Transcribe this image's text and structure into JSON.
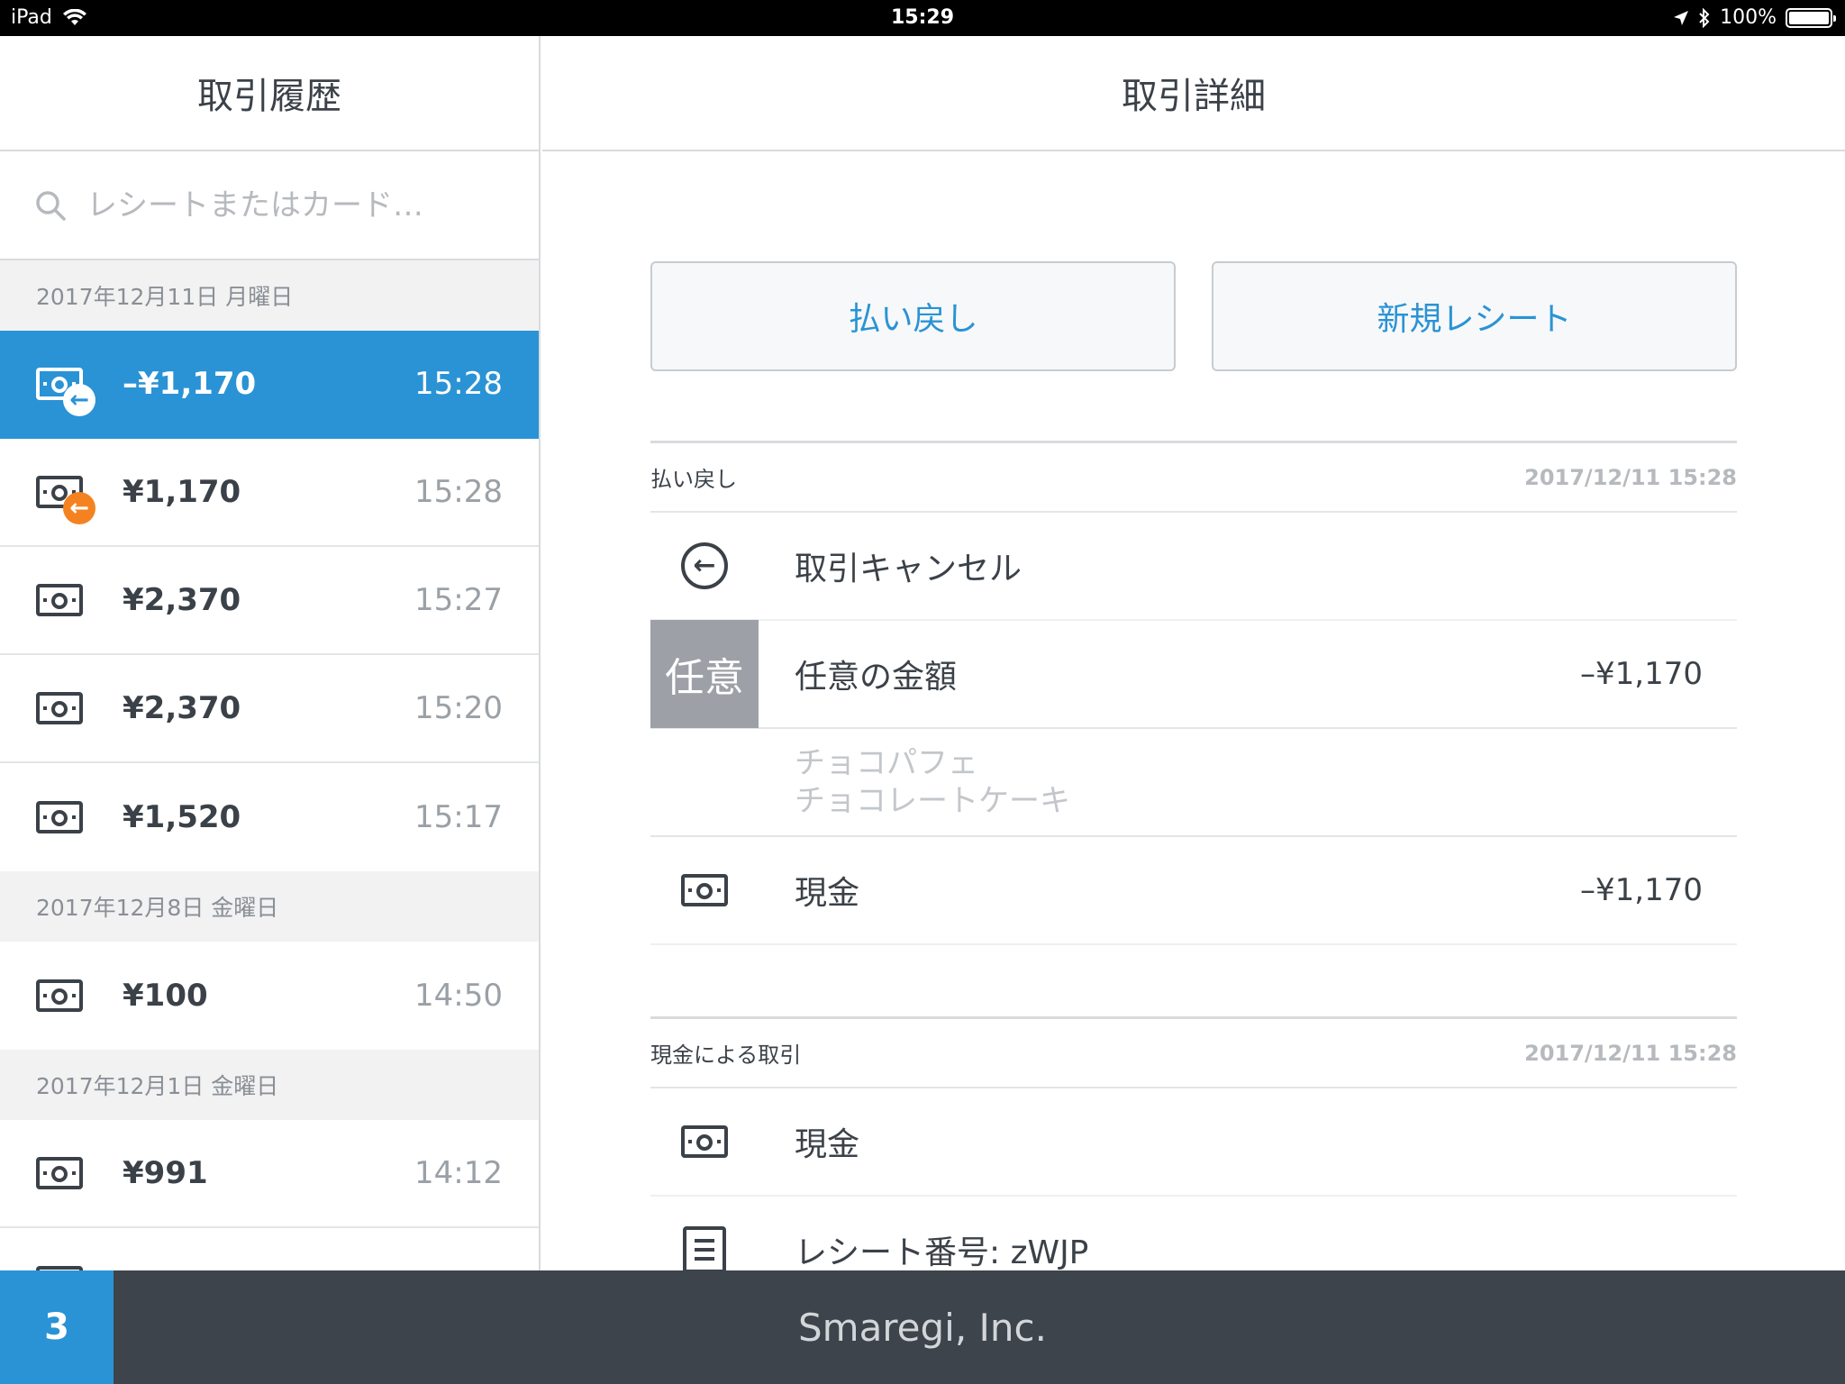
{
  "status_bar": {
    "device": "iPad",
    "time": "15:29",
    "battery": "100%"
  },
  "left_panel": {
    "title": "取引履歴",
    "search_placeholder": "レシートまたはカード…",
    "groups": [
      {
        "date": "2017年12月11日 月曜日",
        "items": [
          {
            "amount": "–¥1,170",
            "time": "15:28",
            "badge": "refund-white",
            "selected": true
          },
          {
            "amount": "¥1,170",
            "time": "15:28",
            "badge": "refund-orange"
          },
          {
            "amount": "¥2,370",
            "time": "15:27"
          },
          {
            "amount": "¥2,370",
            "time": "15:20"
          },
          {
            "amount": "¥1,520",
            "time": "15:17"
          }
        ]
      },
      {
        "date": "2017年12月8日 金曜日",
        "items": [
          {
            "amount": "¥100",
            "time": "14:50"
          }
        ]
      },
      {
        "date": "2017年12月1日 金曜日",
        "items": [
          {
            "amount": "¥991",
            "time": "14:12"
          }
        ]
      }
    ]
  },
  "right_panel": {
    "title": "取引詳細",
    "buttons": {
      "refund": "払い戻し",
      "new_receipt": "新規レシート"
    },
    "refund_section": {
      "title": "払い戻し",
      "date": "2017/12/11 15:28",
      "cancel_label": "取引キャンセル",
      "custom_tile": "任意",
      "custom_label": "任意の金額",
      "custom_value": "–¥1,170",
      "items": [
        "チョコパフェ",
        "チョコレートケーキ"
      ],
      "cash_label": "現金",
      "cash_value": "–¥1,170"
    },
    "cash_section": {
      "title": "現金による取引",
      "date": "2017/12/11 15:28",
      "cash_label": "現金",
      "receipt_label": "レシート番号: zWJP"
    }
  },
  "bottom_bar": {
    "count": "3",
    "company": "Smaregi, Inc."
  },
  "colors": {
    "accent": "#2a93d5",
    "refund_badge": "#f58220",
    "bottom_bar": "#3d444b"
  }
}
